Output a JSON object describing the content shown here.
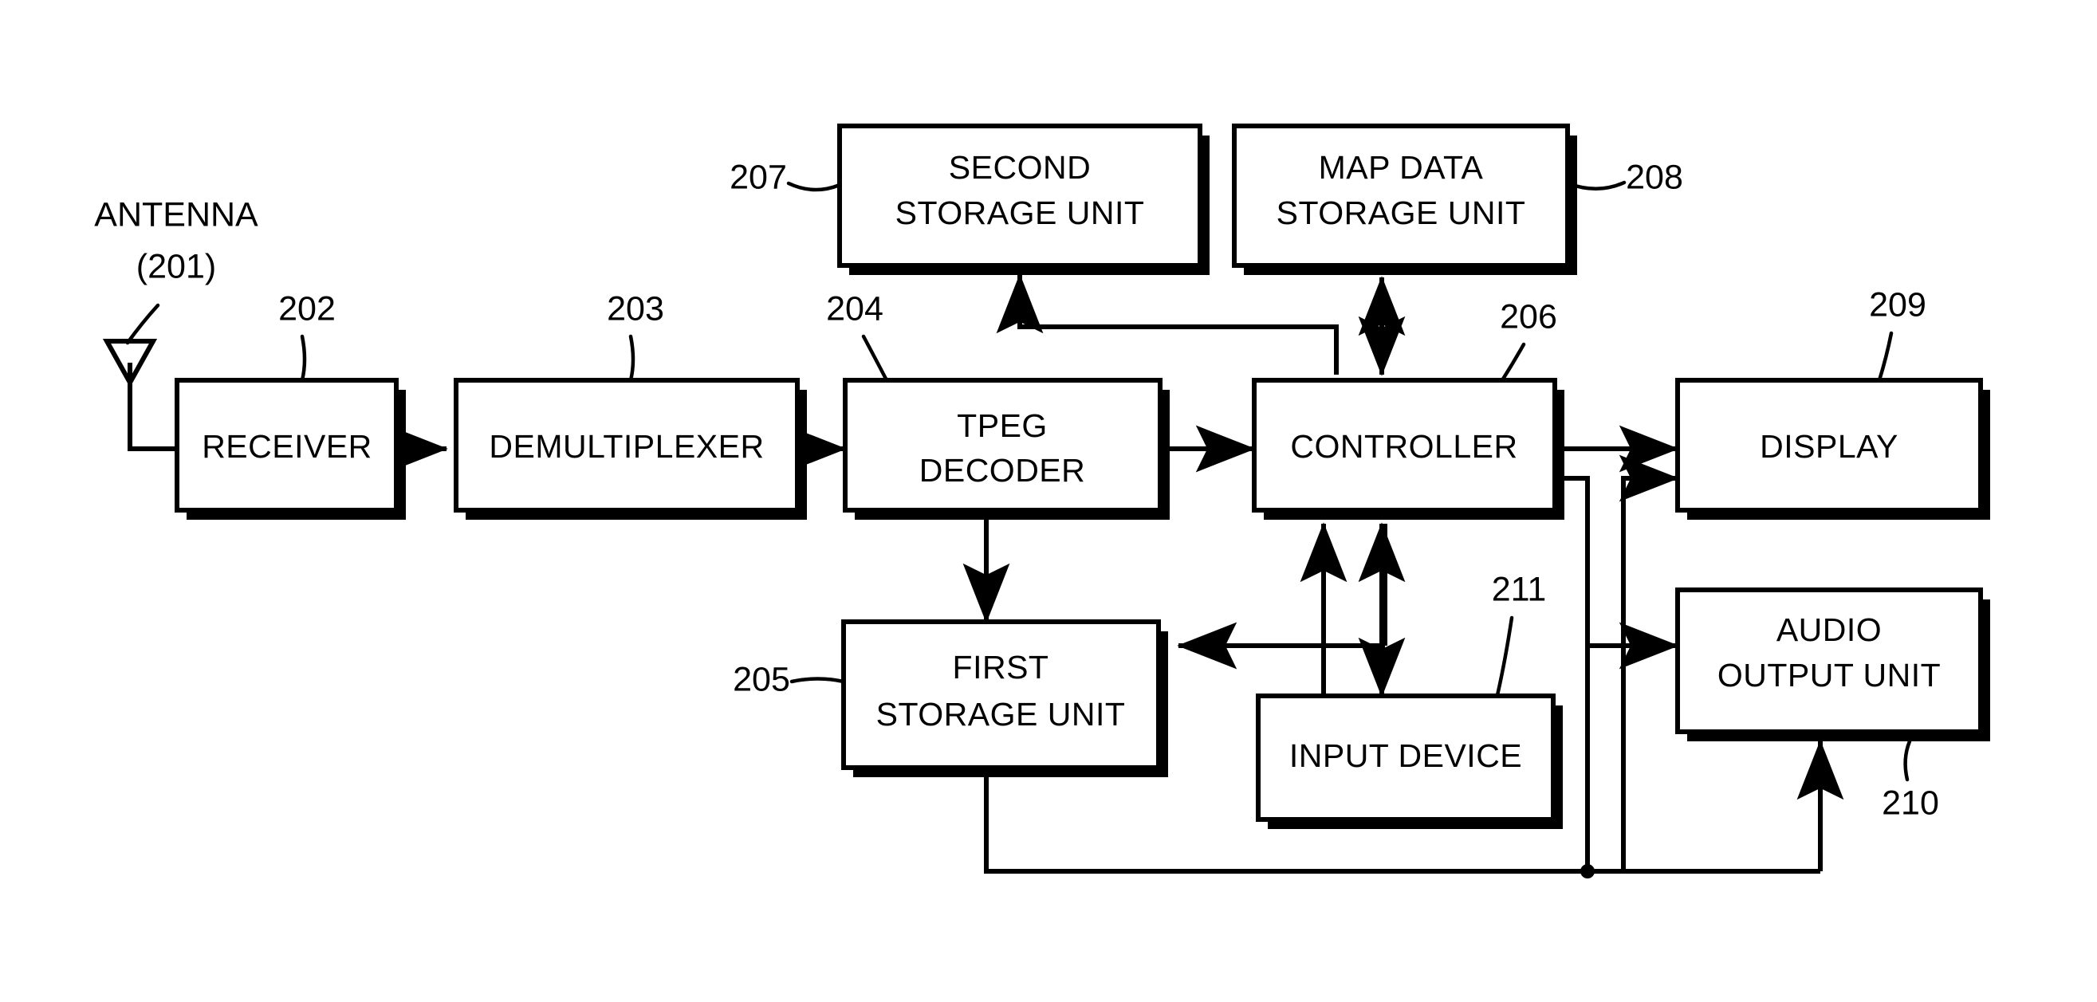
{
  "figure": {
    "kind": "patent-block-diagram",
    "background_color": "#ffffff",
    "line_color": "#000000"
  },
  "antenna": {
    "label_line1": "ANTENNA",
    "label_line2": "(201)",
    "ref": "201",
    "icon": "antenna-icon"
  },
  "blocks": [
    {
      "id": "receiver",
      "ref": "202",
      "lines": [
        "RECEIVER"
      ]
    },
    {
      "id": "demultiplexer",
      "ref": "203",
      "lines": [
        "DEMULTIPLEXER"
      ]
    },
    {
      "id": "tpeg_decoder",
      "ref": "204",
      "lines": [
        "TPEG",
        "DECODER"
      ]
    },
    {
      "id": "first_storage",
      "ref": "205",
      "lines": [
        "FIRST",
        "STORAGE UNIT"
      ]
    },
    {
      "id": "controller",
      "ref": "206",
      "lines": [
        "CONTROLLER"
      ]
    },
    {
      "id": "second_storage",
      "ref": "207",
      "lines": [
        "SECOND",
        "STORAGE UNIT"
      ]
    },
    {
      "id": "map_data_storage",
      "ref": "208",
      "lines": [
        "MAP DATA",
        "STORAGE UNIT"
      ]
    },
    {
      "id": "display",
      "ref": "209",
      "lines": [
        "DISPLAY"
      ]
    },
    {
      "id": "audio_output",
      "ref": "210",
      "lines": [
        "AUDIO",
        "OUTPUT UNIT"
      ]
    },
    {
      "id": "input_device",
      "ref": "211",
      "lines": [
        "INPUT DEVICE"
      ]
    }
  ],
  "refs": {
    "r202": "202",
    "r203": "203",
    "r204": "204",
    "r205": "205",
    "r206": "206",
    "r207": "207",
    "r208": "208",
    "r209": "209",
    "r210": "210",
    "r211": "211"
  },
  "block_labels": {
    "receiver": "RECEIVER",
    "demultiplexer": "DEMULTIPLEXER",
    "tpeg_l1": "TPEG",
    "tpeg_l2": "DECODER",
    "first_l1": "FIRST",
    "first_l2": "STORAGE UNIT",
    "controller": "CONTROLLER",
    "second_l1": "SECOND",
    "second_l2": "STORAGE UNIT",
    "map_l1": "MAP DATA",
    "map_l2": "STORAGE UNIT",
    "display": "DISPLAY",
    "audio_l1": "AUDIO",
    "audio_l2": "OUTPUT UNIT",
    "input_device": "INPUT DEVICE"
  },
  "connections": [
    {
      "from": "antenna",
      "to": "receiver",
      "arrow": "single"
    },
    {
      "from": "receiver",
      "to": "demultiplexer",
      "arrow": "single"
    },
    {
      "from": "demultiplexer",
      "to": "tpeg_decoder",
      "arrow": "single"
    },
    {
      "from": "tpeg_decoder",
      "to": "controller",
      "arrow": "single"
    },
    {
      "from": "tpeg_decoder",
      "to": "first_storage",
      "arrow": "single"
    },
    {
      "from": "controller",
      "to": "second_storage",
      "arrow": "single"
    },
    {
      "from": "controller",
      "to": "map_data_storage",
      "arrow": "double"
    },
    {
      "from": "controller",
      "to": "display",
      "arrow": "single"
    },
    {
      "from": "controller",
      "to": "first_storage",
      "arrow": "single"
    },
    {
      "from": "controller",
      "to": "input_device",
      "arrow": "double"
    },
    {
      "from": "controller",
      "to": "audio_output",
      "arrow": "single"
    },
    {
      "from": "first_storage",
      "to": "display",
      "arrow": "single"
    },
    {
      "from": "first_storage",
      "to": "audio_output",
      "arrow": "single"
    }
  ]
}
